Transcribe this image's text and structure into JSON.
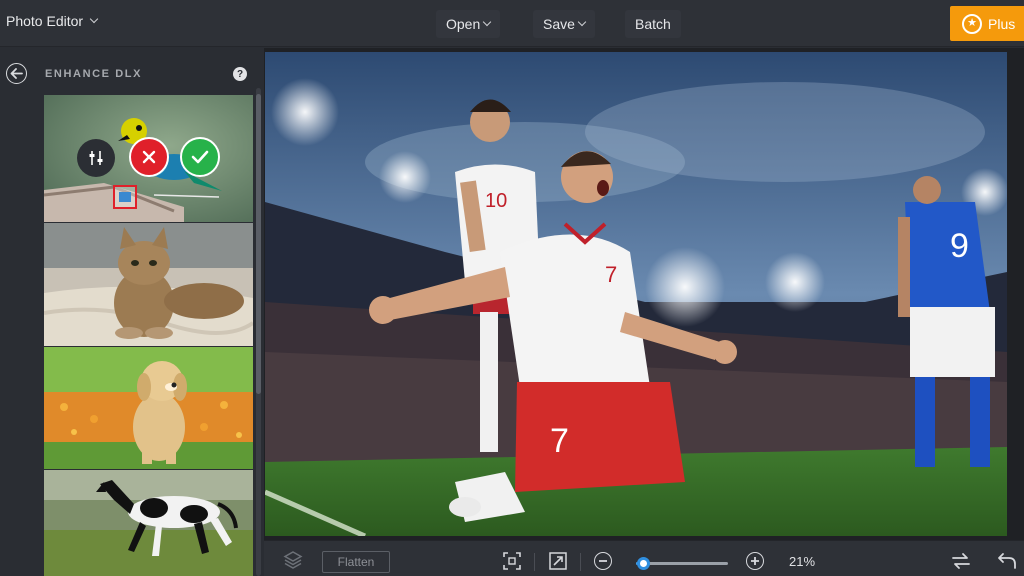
{
  "app": {
    "menu_label": "Photo Editor"
  },
  "toolbar": {
    "open_label": "Open",
    "save_label": "Save",
    "batch_label": "Batch",
    "plus_label": "Plus"
  },
  "panel": {
    "title": "ENHANCE DLX",
    "help": "?"
  },
  "thumbnails": [
    "bird-photo",
    "cat-photo",
    "puppy-photo",
    "horse-photo"
  ],
  "bottombar": {
    "flatten_label": "Flatten",
    "zoom_label": "21%",
    "zoom_fraction": 0.08
  },
  "colors": {
    "accent": "#f59a0c",
    "slider": "#2f8fe0",
    "cancel": "#e0202a",
    "confirm": "#27b24a"
  }
}
